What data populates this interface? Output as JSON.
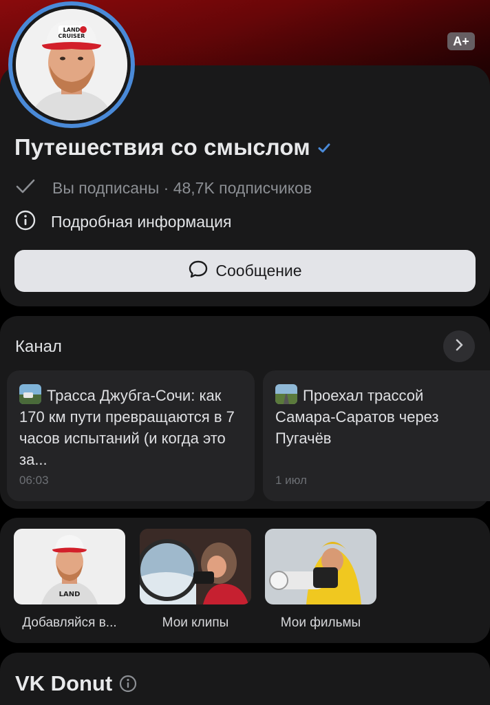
{
  "header": {
    "font_size_button": "A+",
    "channel_name": "Путешествия со смыслом",
    "subscription_status": "Вы подписаны · 48,7K подписчиков",
    "details_label": "Подробная информация",
    "message_button": "Сообщение"
  },
  "channel": {
    "title": "Канал",
    "posts": [
      {
        "text": "Трасса Джубга-Сочи: как 170 км пути превращаются в 7 часов испытаний (и когда это за...",
        "date": "06:03"
      },
      {
        "text": "Проехал трассой Самара-Саратов через Пугачёв",
        "date": "1 июл"
      }
    ]
  },
  "media": [
    {
      "label": "Добавляйся в..."
    },
    {
      "label": "Мои клипы"
    },
    {
      "label": "Мои фильмы"
    }
  ],
  "donut": {
    "title": "VK Donut"
  },
  "colors": {
    "background": "#000000",
    "card": "#19191a",
    "accent_blue": "#4a8ad8",
    "cover_red": "#8a0a0c",
    "button_light": "#e3e4e8"
  },
  "icons": [
    "checkmark-icon",
    "info-icon",
    "chat-bubble-icon",
    "chevron-right-icon",
    "verified-badge-icon"
  ]
}
